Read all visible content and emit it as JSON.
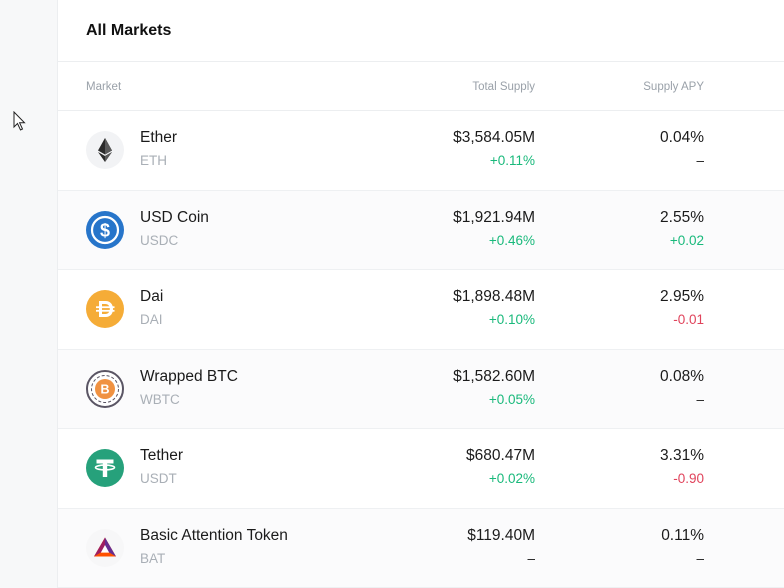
{
  "panel": {
    "title": "All Markets"
  },
  "columns": {
    "market": "Market",
    "total_supply": "Total Supply",
    "supply_apy": "Supply APY"
  },
  "markets": [
    {
      "icon": "ether-icon",
      "name": "Ether",
      "symbol": "ETH",
      "total_supply": "$3,584.05M",
      "supply_change": "+0.11%",
      "supply_change_dir": "positive",
      "apy": "0.04%",
      "apy_change": "–",
      "apy_change_dir": "flat"
    },
    {
      "icon": "usdc-icon",
      "name": "USD Coin",
      "symbol": "USDC",
      "total_supply": "$1,921.94M",
      "supply_change": "+0.46%",
      "supply_change_dir": "positive",
      "apy": "2.55%",
      "apy_change": "+0.02",
      "apy_change_dir": "positive"
    },
    {
      "icon": "dai-icon",
      "name": "Dai",
      "symbol": "DAI",
      "total_supply": "$1,898.48M",
      "supply_change": "+0.10%",
      "supply_change_dir": "positive",
      "apy": "2.95%",
      "apy_change": "-0.01",
      "apy_change_dir": "negative"
    },
    {
      "icon": "wbtc-icon",
      "name": "Wrapped BTC",
      "symbol": "WBTC",
      "total_supply": "$1,582.60M",
      "supply_change": "+0.05%",
      "supply_change_dir": "positive",
      "apy": "0.08%",
      "apy_change": "–",
      "apy_change_dir": "flat"
    },
    {
      "icon": "tether-icon",
      "name": "Tether",
      "symbol": "USDT",
      "total_supply": "$680.47M",
      "supply_change": "+0.02%",
      "supply_change_dir": "positive",
      "apy": "3.31%",
      "apy_change": "-0.90",
      "apy_change_dir": "negative"
    },
    {
      "icon": "bat-icon",
      "name": "Basic Attention Token",
      "symbol": "BAT",
      "total_supply": "$119.40M",
      "supply_change": "–",
      "supply_change_dir": "flat",
      "apy": "0.11%",
      "apy_change": "–",
      "apy_change_dir": "flat"
    }
  ],
  "colors": {
    "positive": "#19b97b",
    "negative": "#e0435b",
    "usdc": "#2775ca",
    "dai": "#f5ac37",
    "tether": "#26a17b",
    "wbtc": "#f09242"
  }
}
